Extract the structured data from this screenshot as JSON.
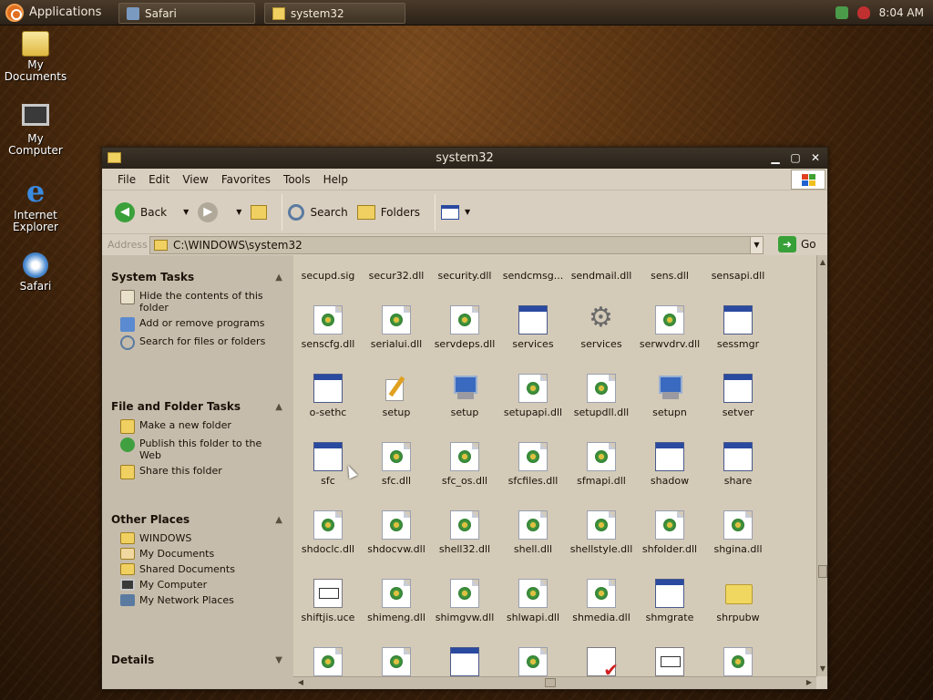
{
  "panel": {
    "apps_label": "Applications",
    "tasks": [
      {
        "label": "Safari"
      },
      {
        "label": "system32"
      }
    ],
    "clock": "8:04 AM"
  },
  "desktop_icons": [
    {
      "label": "My Documents",
      "icon": "documents-folder-icon"
    },
    {
      "label": "My Computer",
      "icon": "computer-icon"
    },
    {
      "label": "Internet Explorer",
      "icon": "ie-icon"
    },
    {
      "label": "Safari",
      "icon": "safari-icon"
    }
  ],
  "window": {
    "title": "system32",
    "menu": [
      "File",
      "Edit",
      "View",
      "Favorites",
      "Tools",
      "Help"
    ],
    "toolbar": {
      "back": "Back",
      "search": "Search",
      "folders": "Folders"
    },
    "address": {
      "label": "Address",
      "path": "C:\\WINDOWS\\system32",
      "go": "Go"
    }
  },
  "taskpane": {
    "system_tasks": {
      "title": "System Tasks",
      "items": [
        "Hide the contents of this folder",
        "Add or remove programs",
        "Search for files or folders"
      ]
    },
    "file_tasks": {
      "title": "File and Folder Tasks",
      "items": [
        "Make a new folder",
        "Publish this folder to the Web",
        "Share this folder"
      ]
    },
    "other_places": {
      "title": "Other Places",
      "items": [
        "WINDOWS",
        "My Documents",
        "Shared Documents",
        "My Computer",
        "My Network Places"
      ]
    },
    "details": {
      "title": "Details"
    }
  },
  "files": [
    [
      "secupd.sig",
      "secur32.dll",
      "security.dll",
      "sendcmsg...",
      "sendmail.dll",
      "sens.dll",
      "sensapi.dll"
    ],
    [
      "senscfg.dll",
      "serialui.dll",
      "servdeps.dll",
      "services",
      "services",
      "serwvdrv.dll",
      "sessmgr"
    ],
    [
      "o-sethc",
      "setup",
      "setup",
      "setupapi.dll",
      "setupdll.dll",
      "setupn",
      "setver"
    ],
    [
      "sfc",
      "sfc.dll",
      "sfc_os.dll",
      "sfcfiles.dll",
      "sfmapi.dll",
      "shadow",
      "share"
    ],
    [
      "shdoclc.dll",
      "shdocvw.dll",
      "shell32.dll",
      "shell.dll",
      "shellstyle.dll",
      "shfolder.dll",
      "shgina.dll"
    ],
    [
      "shiftjis.uce",
      "shimeng.dll",
      "shimgvw.dll",
      "shlwapi.dll",
      "shmedia.dll",
      "shmgrate",
      "shrpubw"
    ],
    [
      "",
      "",
      "",
      "",
      "",
      "",
      ""
    ]
  ],
  "file_types": [
    [
      "none",
      "none",
      "none",
      "none",
      "none",
      "none",
      "none"
    ],
    [
      "dll",
      "dll",
      "dll",
      "app",
      "gear",
      "dll",
      "app"
    ],
    [
      "app",
      "edit",
      "comp",
      "dll",
      "dll",
      "comp",
      "app"
    ],
    [
      "app",
      "dll",
      "dll",
      "dll",
      "dll",
      "app",
      "app"
    ],
    [
      "dll",
      "dll",
      "dll",
      "dll",
      "dll",
      "dll",
      "dll"
    ],
    [
      "txt",
      "dll",
      "dll",
      "dll",
      "dll",
      "app",
      "folder"
    ],
    [
      "dll",
      "dll",
      "app",
      "dll",
      "check",
      "txt",
      "dll"
    ]
  ]
}
